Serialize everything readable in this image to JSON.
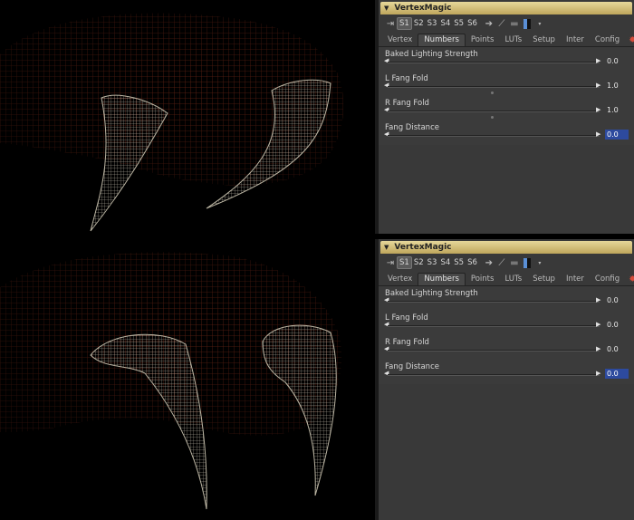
{
  "colors": {
    "title_bar": "#d6c37c",
    "panel_bg": "#393939",
    "wire_red": "#8a2d1c",
    "fang_wire": "#d8d2c0",
    "value_highlight": "#2d4a9e"
  },
  "panels": [
    {
      "title": "VertexMagic",
      "slots": [
        "S1",
        "S2",
        "S3",
        "S4",
        "S5",
        "S6"
      ],
      "active_slot": "S1",
      "tabs": [
        "Vertex",
        "Numbers",
        "Points",
        "LUTs",
        "Setup",
        "Inter",
        "Config"
      ],
      "active_tab": "Numbers",
      "params": [
        {
          "label": "Baked Lighting Strength",
          "value": "0.0"
        },
        {
          "label": "L Fang Fold",
          "value": "1.0"
        },
        {
          "label": "R Fang Fold",
          "value": "1.0"
        },
        {
          "label": "Fang Distance",
          "value": "0.0"
        }
      ]
    },
    {
      "title": "VertexMagic",
      "slots": [
        "S1",
        "S2",
        "S3",
        "S4",
        "S5",
        "S6"
      ],
      "active_slot": "S1",
      "tabs": [
        "Vertex",
        "Numbers",
        "Points",
        "LUTs",
        "Setup",
        "Inter",
        "Config"
      ],
      "active_tab": "Numbers",
      "params": [
        {
          "label": "Baked Lighting Strength",
          "value": "0.0"
        },
        {
          "label": "L Fang Fold",
          "value": "0.0"
        },
        {
          "label": "R Fang Fold",
          "value": "0.0"
        },
        {
          "label": "Fang Distance",
          "value": "0.0"
        }
      ]
    }
  ],
  "icons": {
    "pin": "pin-icon",
    "link": "link-icon",
    "wand": "wand-icon",
    "chat": "comment-icon",
    "swatch": "color-swatch-icon",
    "gear": "gear-icon",
    "info": "info-icon"
  }
}
